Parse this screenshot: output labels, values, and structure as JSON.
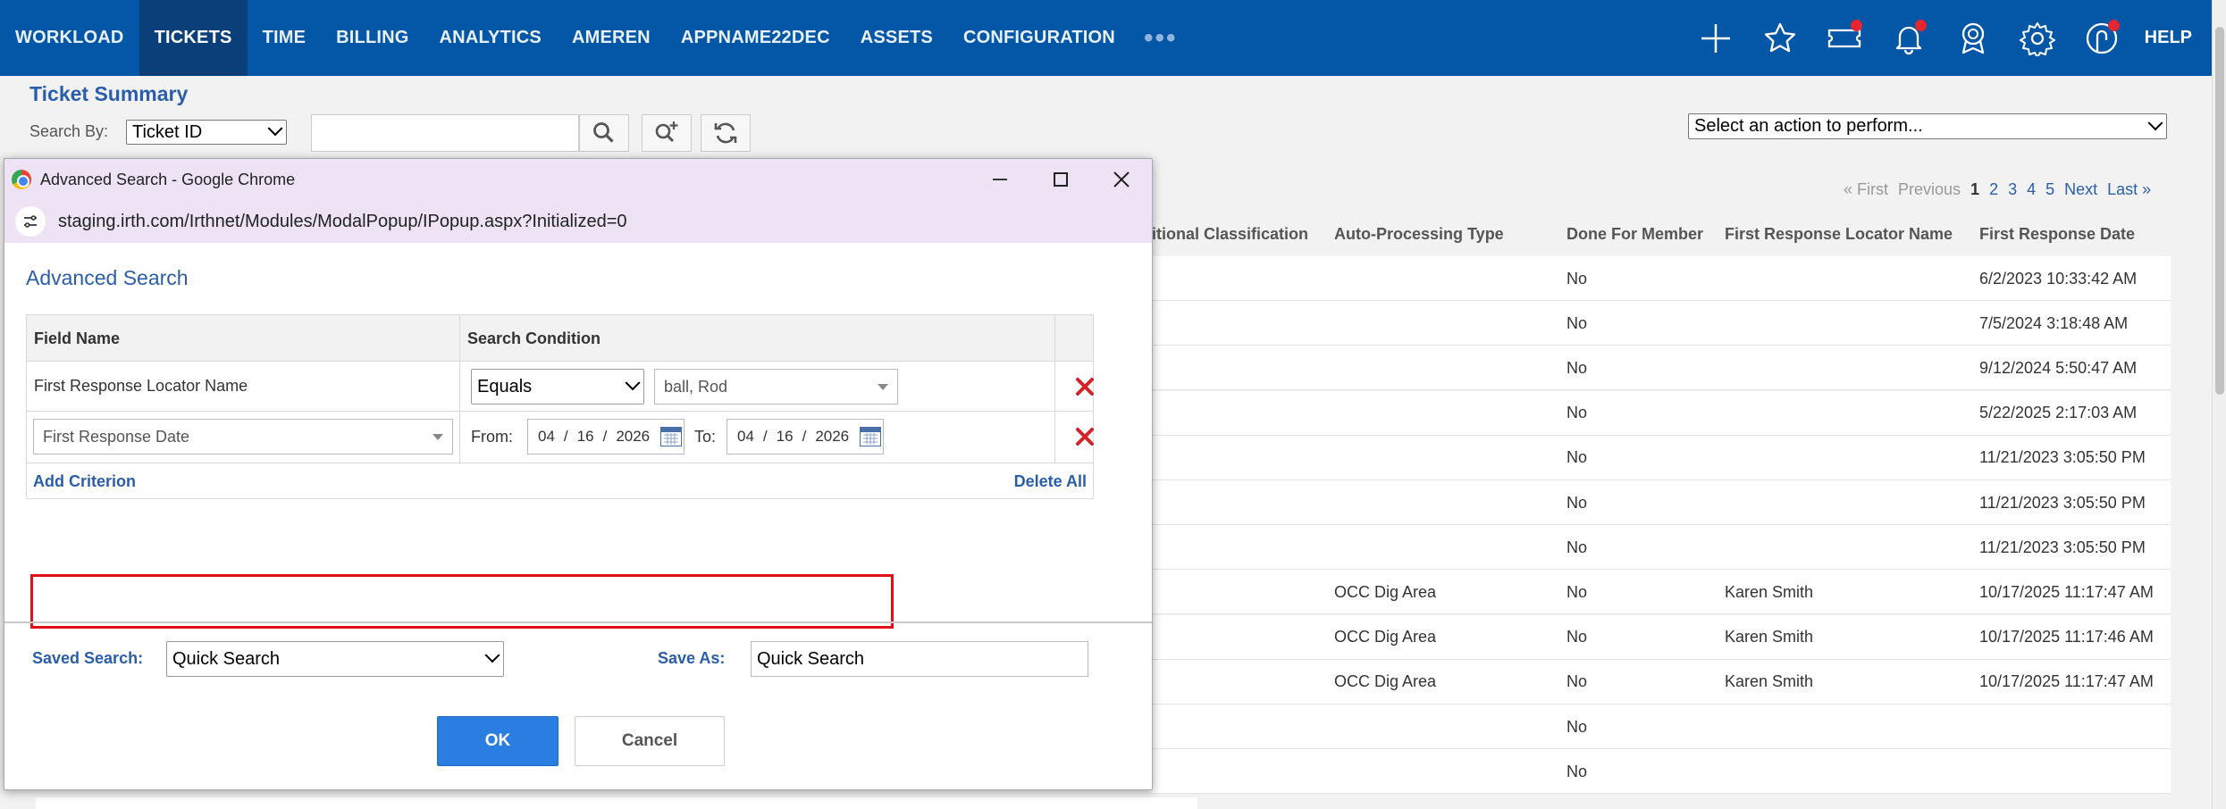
{
  "nav": {
    "items": [
      "WORKLOAD",
      "TICKETS",
      "TIME",
      "BILLING",
      "ANALYTICS",
      "AMEREN",
      "APPNAME22DEC",
      "ASSETS",
      "CONFIGURATION"
    ],
    "more": "•••",
    "help": "HELP"
  },
  "page": {
    "title": "Ticket Summary",
    "search_by_label": "Search By:",
    "search_by_value": "Ticket ID",
    "action_select": "Select an action to perform..."
  },
  "pager": {
    "first": "« First",
    "previous": "Previous",
    "pages": [
      "1",
      "2",
      "3",
      "4",
      "5"
    ],
    "next": "Next",
    "last": "Last »"
  },
  "grid": {
    "headers": [
      "itional Classification",
      "Auto-Processing Type",
      "Done For Member",
      "First Response Locator Name",
      "First Response Date"
    ],
    "rows": [
      {
        "type": "",
        "done": "No",
        "locator": "",
        "date": "6/2/2023 10:33:42 AM"
      },
      {
        "type": "",
        "done": "No",
        "locator": "",
        "date": "7/5/2024 3:18:48 AM"
      },
      {
        "type": "",
        "done": "No",
        "locator": "",
        "date": "9/12/2024 5:50:47 AM"
      },
      {
        "type": "",
        "done": "No",
        "locator": "",
        "date": "5/22/2025 2:17:03 AM"
      },
      {
        "type": "",
        "done": "No",
        "locator": "",
        "date": "11/21/2023 3:05:50 PM"
      },
      {
        "type": "",
        "done": "No",
        "locator": "",
        "date": "11/21/2023 3:05:50 PM"
      },
      {
        "type": "",
        "done": "No",
        "locator": "",
        "date": "11/21/2023 3:05:50 PM"
      },
      {
        "type": "OCC Dig Area",
        "done": "No",
        "locator": "Karen Smith",
        "date": "10/17/2025 11:17:47 AM"
      },
      {
        "type": "OCC Dig Area",
        "done": "No",
        "locator": "Karen Smith",
        "date": "10/17/2025 11:17:46 AM"
      },
      {
        "type": "OCC Dig Area",
        "done": "No",
        "locator": "Karen Smith",
        "date": "10/17/2025 11:17:47 AM"
      },
      {
        "type": "",
        "done": "No",
        "locator": "",
        "date": ""
      },
      {
        "type": "",
        "done": "No",
        "locator": "",
        "date": ""
      }
    ]
  },
  "modal": {
    "window_title": "Advanced Search - Google Chrome",
    "url": "staging.irth.com/Irthnet/Modules/ModalPopup/IPopup.aspx?Initialized=0",
    "heading": "Advanced Search",
    "col_field": "Field Name",
    "col_condition": "Search Condition",
    "row1": {
      "field": "First Response Locator Name",
      "operator": "Equals",
      "value": "ball, Rod"
    },
    "row2": {
      "field": "First Response Date",
      "from_label": "From:",
      "from": {
        "m": "04",
        "d": "16",
        "y": "2026"
      },
      "to_label": "To:",
      "to": {
        "m": "04",
        "d": "16",
        "y": "2026"
      },
      "sep": "/"
    },
    "add_criterion": "Add Criterion",
    "delete_all": "Delete All",
    "saved_search_label": "Saved Search:",
    "saved_search_value": "Quick Search",
    "save_as_label": "Save As:",
    "save_as_value": "Quick Search",
    "ok": "OK",
    "cancel": "Cancel"
  }
}
